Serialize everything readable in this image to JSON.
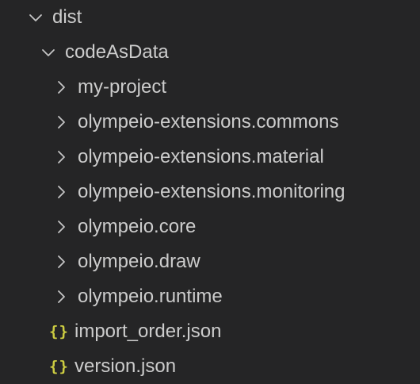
{
  "explorer": {
    "icon_colors": {
      "text": "#cccccc",
      "chevron": "#c5c5c5",
      "json_icon": "#cbcb41",
      "background": "#252526"
    },
    "items": [
      {
        "label": "dist",
        "kind": "folder",
        "expanded": true,
        "depth": 0,
        "icon": "chevron-down-icon"
      },
      {
        "label": "codeAsData",
        "kind": "folder",
        "expanded": true,
        "depth": 1,
        "icon": "chevron-down-icon"
      },
      {
        "label": "my-project",
        "kind": "folder",
        "expanded": false,
        "depth": 2,
        "icon": "chevron-right-icon"
      },
      {
        "label": "olympeio-extensions.commons",
        "kind": "folder",
        "expanded": false,
        "depth": 2,
        "icon": "chevron-right-icon"
      },
      {
        "label": "olympeio-extensions.material",
        "kind": "folder",
        "expanded": false,
        "depth": 2,
        "icon": "chevron-right-icon"
      },
      {
        "label": "olympeio-extensions.monitoring",
        "kind": "folder",
        "expanded": false,
        "depth": 2,
        "icon": "chevron-right-icon"
      },
      {
        "label": "olympeio.core",
        "kind": "folder",
        "expanded": false,
        "depth": 2,
        "icon": "chevron-right-icon"
      },
      {
        "label": "olympeio.draw",
        "kind": "folder",
        "expanded": false,
        "depth": 2,
        "icon": "chevron-right-icon"
      },
      {
        "label": "olympeio.runtime",
        "kind": "folder",
        "expanded": false,
        "depth": 2,
        "icon": "chevron-right-icon"
      },
      {
        "label": "import_order.json",
        "kind": "file",
        "depth": 2,
        "icon": "json-file-icon",
        "icon_glyph": "{}"
      },
      {
        "label": "version.json",
        "kind": "file",
        "depth": 2,
        "icon": "json-file-icon",
        "icon_glyph": "{}"
      }
    ]
  }
}
